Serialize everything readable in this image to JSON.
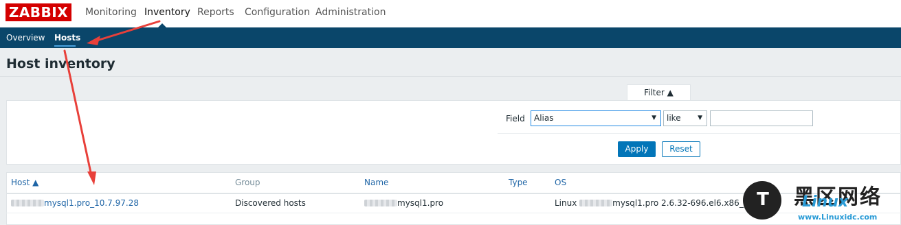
{
  "brand": {
    "logo": "ZABBIX"
  },
  "top_menu": {
    "items": [
      {
        "label": "Monitoring",
        "active": false
      },
      {
        "label": "Inventory",
        "active": true
      },
      {
        "label": "Reports",
        "active": false
      },
      {
        "label": "Configuration",
        "active": false
      },
      {
        "label": "Administration",
        "active": false
      }
    ]
  },
  "sub_menu": {
    "items": [
      {
        "label": "Overview",
        "active": false
      },
      {
        "label": "Hosts",
        "active": true
      }
    ]
  },
  "page": {
    "title": "Host inventory"
  },
  "filter": {
    "tab_label": "Filter ▲",
    "field_label": "Field",
    "field_value": "Alias",
    "operator_value": "like",
    "search_value": "",
    "apply_label": "Apply",
    "reset_label": "Reset"
  },
  "table": {
    "columns": [
      "Host ▲",
      "Group",
      "Name",
      "Type",
      "OS"
    ],
    "rows": [
      {
        "host": "mysql1.pro_10.7.97.28",
        "group": "Discovered hosts",
        "name": "mysql1.pro",
        "type": "",
        "os_prefix": "Linux",
        "os": "mysql1.pro 2.6.32-696.el6.x86_64 #"
      }
    ]
  },
  "watermark": {
    "cn": "黑区网络",
    "en": "Linux",
    "url": "www.Linuxidc.com",
    "icon": "linux-penguin-logo"
  },
  "colors": {
    "brand_red": "#d40000",
    "subnav_blue": "#0a466a",
    "link_blue": "#1f65a6",
    "primary_button": "#0275b8",
    "annotation_arrow": "#e8403a"
  }
}
